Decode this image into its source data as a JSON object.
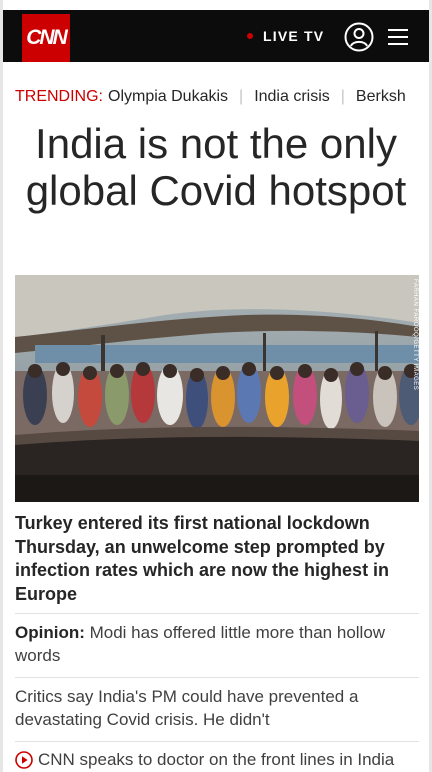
{
  "header": {
    "logo_text": "CNN",
    "live_label": "LIVE TV",
    "brand_color": "#cc0000",
    "icons": [
      "user-icon",
      "menu-icon"
    ]
  },
  "trending": {
    "label": "TRENDING:",
    "items": [
      "Olympia Dukakis",
      "India crisis",
      "Berksh"
    ]
  },
  "headline": "India is not the only global Covid hotspot",
  "photo": {
    "credit": "FARHAN FAROOQ/GETTY IMAGES"
  },
  "lead": "Turkey entered its first national lockdown Thursday, an unwelcome step prompted by infection rates which are now the highest in Europe",
  "stories": [
    {
      "prefix": "Opinion:",
      "text": " Modi has offered little more than hollow words"
    },
    {
      "prefix": "",
      "text": "Critics say India's PM could have prevented a devastating Covid crisis. He didn't"
    }
  ],
  "video_story": {
    "icon": "play-icon",
    "text": "CNN speaks to doctor on the front lines in India"
  }
}
